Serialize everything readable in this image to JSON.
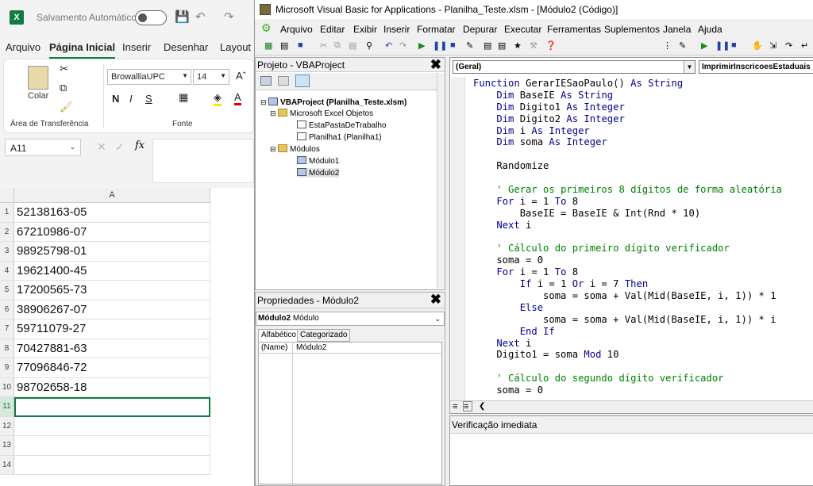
{
  "excel": {
    "autosave_label": "Salvamento Automático",
    "tabs": [
      "Arquivo",
      "Página Inicial",
      "Inserir",
      "Desenhar",
      "Layout"
    ],
    "ribbon": {
      "paste_label": "Colar",
      "clipboard_group": "Área de Transferência",
      "font_group": "Fonte",
      "font_name": "BrowalliaUPC",
      "font_size": "14",
      "bold": "N",
      "italic": "I",
      "underline": "S"
    },
    "name_box": "A11",
    "fx_label": "fx",
    "column_header": "A",
    "rows": [
      {
        "num": "1",
        "value": "52138163-05"
      },
      {
        "num": "2",
        "value": "67210986-07"
      },
      {
        "num": "3",
        "value": "98925798-01"
      },
      {
        "num": "4",
        "value": "19621400-45"
      },
      {
        "num": "5",
        "value": "17200565-73"
      },
      {
        "num": "6",
        "value": "38906267-07"
      },
      {
        "num": "7",
        "value": "59711079-27"
      },
      {
        "num": "8",
        "value": "70427881-63"
      },
      {
        "num": "9",
        "value": "77096846-72"
      },
      {
        "num": "10",
        "value": "98702658-18"
      },
      {
        "num": "11",
        "value": ""
      },
      {
        "num": "12",
        "value": ""
      },
      {
        "num": "13",
        "value": ""
      },
      {
        "num": "14",
        "value": ""
      }
    ]
  },
  "vba": {
    "title": "Microsoft Visual Basic for Applications - Planilha_Teste.xlsm - [Módulo2 (Código)]",
    "menu": [
      "Arquivo",
      "Editar",
      "Exibir",
      "Inserir",
      "Formatar",
      "Depurar",
      "Executar",
      "Ferramentas",
      "Suplementos",
      "Janela",
      "Ajuda"
    ],
    "project_title": "Projeto - VBAProject",
    "tree": {
      "root": "VBAProject (Planilha_Teste.xlsm)",
      "excel_objects": "Microsoft Excel Objetos",
      "this_workbook": "EstaPastaDeTrabalho",
      "sheet1": "Planilha1 (Planilha1)",
      "modules": "Módulos",
      "module1": "Módulo1",
      "module2": "Módulo2"
    },
    "properties_title": "Propriedades - Módulo2",
    "properties_combo_bold": "Módulo2",
    "properties_combo_rest": "Módulo",
    "properties_tabs": [
      "Alfabético",
      "Categorizado"
    ],
    "property_name": "(Name)",
    "property_value": "Módulo2",
    "general_combo": "(Geral)",
    "proc_combo": "ImprimirInscricoesEstaduais",
    "immediate_title": "Verificação imediata",
    "code_lines": [
      [
        {
          "t": "Function ",
          "k": "kw"
        },
        {
          "t": "GerarIESaoPaulo() "
        },
        {
          "t": "As String",
          "k": "kw"
        }
      ],
      [
        {
          "t": "    "
        },
        {
          "t": "Dim",
          "k": "kw"
        },
        {
          "t": " BaseIE "
        },
        {
          "t": "As String",
          "k": "kw"
        }
      ],
      [
        {
          "t": "    "
        },
        {
          "t": "Dim",
          "k": "kw"
        },
        {
          "t": " Digito1 "
        },
        {
          "t": "As Integer",
          "k": "kw"
        }
      ],
      [
        {
          "t": "    "
        },
        {
          "t": "Dim",
          "k": "kw"
        },
        {
          "t": " Digito2 "
        },
        {
          "t": "As Integer",
          "k": "kw"
        }
      ],
      [
        {
          "t": "    "
        },
        {
          "t": "Dim",
          "k": "kw"
        },
        {
          "t": " i "
        },
        {
          "t": "As Integer",
          "k": "kw"
        }
      ],
      [
        {
          "t": "    "
        },
        {
          "t": "Dim",
          "k": "kw"
        },
        {
          "t": " soma "
        },
        {
          "t": "As Integer",
          "k": "kw"
        }
      ],
      [
        {
          "t": ""
        }
      ],
      [
        {
          "t": "    Randomize"
        }
      ],
      [
        {
          "t": ""
        }
      ],
      [
        {
          "t": "    "
        },
        {
          "t": "' Gerar os primeiros 8 dígitos de forma aleatória",
          "k": "cm"
        }
      ],
      [
        {
          "t": "    "
        },
        {
          "t": "For",
          "k": "kw"
        },
        {
          "t": " i = 1 "
        },
        {
          "t": "To",
          "k": "kw"
        },
        {
          "t": " 8"
        }
      ],
      [
        {
          "t": "        BaseIE = BaseIE & Int(Rnd * 10)"
        }
      ],
      [
        {
          "t": "    "
        },
        {
          "t": "Next",
          "k": "kw"
        },
        {
          "t": " i"
        }
      ],
      [
        {
          "t": ""
        }
      ],
      [
        {
          "t": "    "
        },
        {
          "t": "' Cálculo do primeiro dígito verificador",
          "k": "cm"
        }
      ],
      [
        {
          "t": "    soma = 0"
        }
      ],
      [
        {
          "t": "    "
        },
        {
          "t": "For",
          "k": "kw"
        },
        {
          "t": " i = 1 "
        },
        {
          "t": "To",
          "k": "kw"
        },
        {
          "t": " 8"
        }
      ],
      [
        {
          "t": "        "
        },
        {
          "t": "If",
          "k": "kw"
        },
        {
          "t": " i = 1 "
        },
        {
          "t": "Or",
          "k": "kw"
        },
        {
          "t": " i = 7 "
        },
        {
          "t": "Then",
          "k": "kw"
        }
      ],
      [
        {
          "t": "            soma = soma + Val(Mid(BaseIE, i, 1)) * 1"
        }
      ],
      [
        {
          "t": "        "
        },
        {
          "t": "Else",
          "k": "kw"
        }
      ],
      [
        {
          "t": "            soma = soma + Val(Mid(BaseIE, i, 1)) * i"
        }
      ],
      [
        {
          "t": "        "
        },
        {
          "t": "End If",
          "k": "kw"
        }
      ],
      [
        {
          "t": "    "
        },
        {
          "t": "Next",
          "k": "kw"
        },
        {
          "t": " i"
        }
      ],
      [
        {
          "t": "    Digito1 = soma "
        },
        {
          "t": "Mod",
          "k": "kw"
        },
        {
          "t": " 10"
        }
      ],
      [
        {
          "t": ""
        }
      ],
      [
        {
          "t": "    "
        },
        {
          "t": "' Cálculo do segundo dígito verificador",
          "k": "cm"
        }
      ],
      [
        {
          "t": "    soma = 0"
        }
      ]
    ]
  }
}
